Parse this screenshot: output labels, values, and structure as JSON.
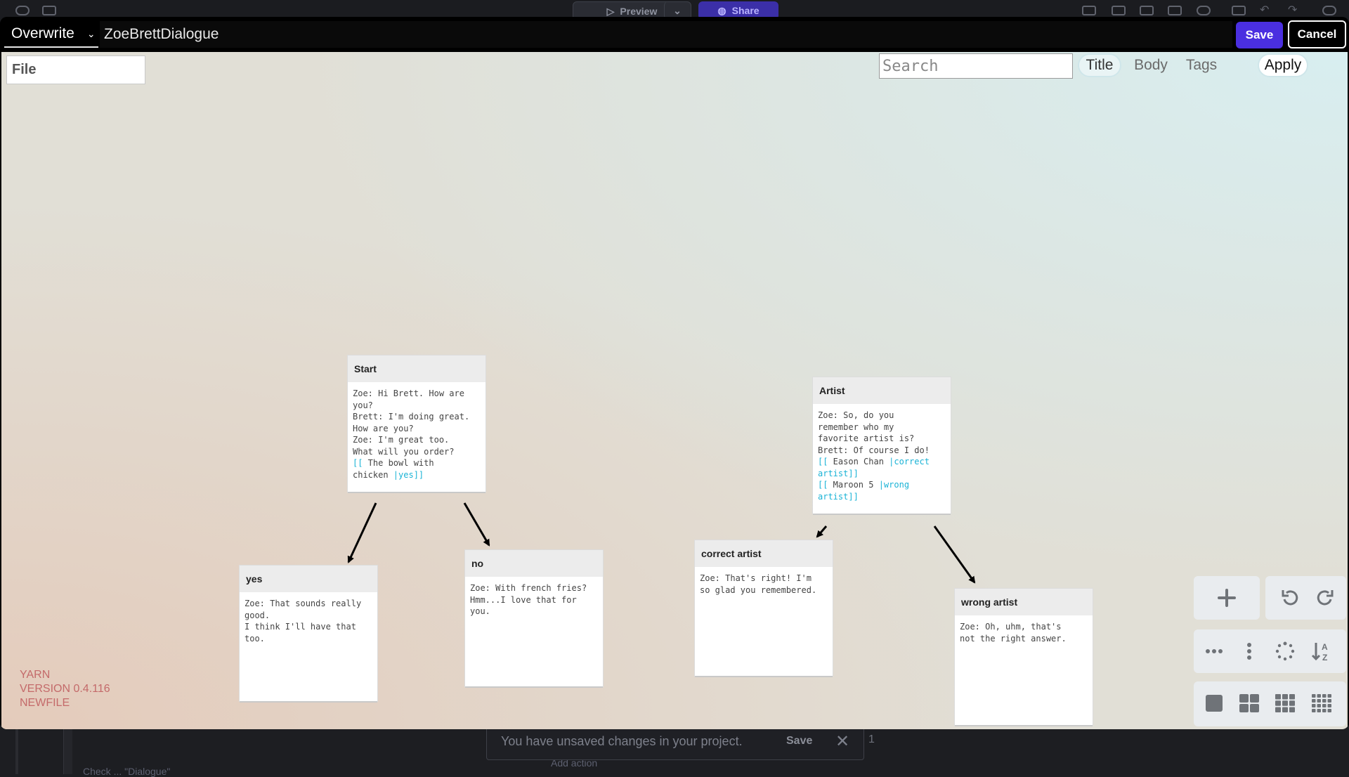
{
  "background_app": {
    "preview_label": "Preview",
    "share_label": "Share",
    "toast_message": "You have unsaved changes in your project.",
    "toast_save": "Save",
    "toast_close": "✕",
    "toast_count": "1",
    "code_fragment_1": "Add action",
    "code_fragment_2": "Check ... \"Dialogue\""
  },
  "toolbar": {
    "mode": "Overwrite",
    "filename": "ZoeBrettDialogue",
    "save_label": "Save",
    "cancel_label": "Cancel"
  },
  "canvas": {
    "file_placeholder": "File",
    "search_placeholder": "Search",
    "filters": [
      "Title",
      "Body",
      "Tags"
    ],
    "active_filter": "Title",
    "apply_label": "Apply",
    "version": {
      "name": "YARN",
      "version": "VERSION 0.4.116",
      "file": "NEWFILE"
    }
  },
  "nodes": {
    "start": {
      "title": "Start",
      "body": "Zoe: Hi Brett. How are\nyou?\nBrett: I'm doing great.\nHow are you?\nZoe: I'm great too.\nWhat will you order?\n",
      "link_open": "[[",
      "link_text": " The bowl with\nchicken ",
      "link_target": "|yes]]"
    },
    "yes": {
      "title": "yes",
      "body": "Zoe: That sounds really\ngood.\nI think I'll have that\ntoo."
    },
    "no": {
      "title": "no",
      "body": "Zoe: With french fries?\nHmm...I love that for\nyou."
    },
    "artist": {
      "title": "Artist",
      "body": "Zoe: So, do you\nremember who my\nfavorite artist is?\nBrett: Of course I do!\n",
      "link1_open": "[[",
      "link1_text": " Eason Chan ",
      "link1_target": "|correct\nartist]]",
      "link2_open": "[[",
      "link2_text": " Maroon 5 ",
      "link2_target": "|wrong\nartist]]"
    },
    "correct_artist": {
      "title": "correct artist",
      "body": "Zoe: That's right! I'm\nso glad you remembered."
    },
    "wrong_artist": {
      "title": "wrong artist",
      "body": "Zoe: Oh, uhm, that's\nnot the right answer."
    }
  },
  "colors": {
    "accent": "#4a2fe0",
    "link": "#1ab3d6",
    "version_text": "#c46a6a"
  },
  "icons": [
    "plus-icon",
    "undo-icon",
    "redo-icon",
    "more-horizontal-icon",
    "more-vertical-icon",
    "loading-icon",
    "sort-az-icon",
    "grid-1-icon",
    "grid-2-icon",
    "grid-3-icon",
    "grid-4-icon"
  ]
}
